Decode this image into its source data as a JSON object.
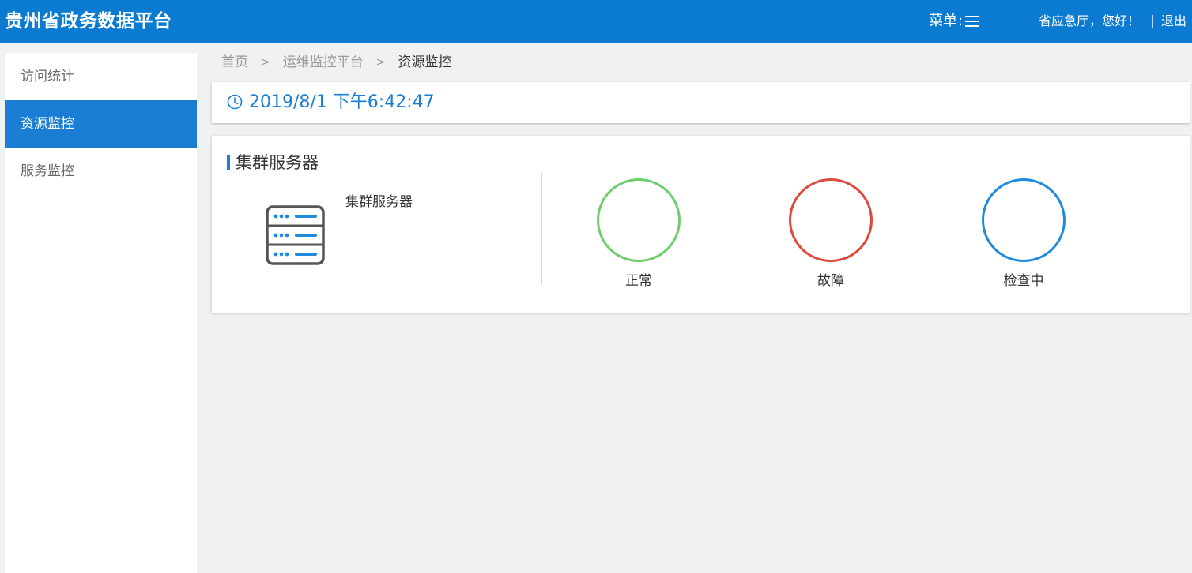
{
  "header": {
    "app_title": "贵州省政务数据平台",
    "menu_label": "菜单",
    "greeting": "省应急厅，您好！",
    "logout_label": "退出"
  },
  "sidebar": {
    "items": [
      {
        "label": "访问统计",
        "active": false
      },
      {
        "label": "资源监控",
        "active": true
      },
      {
        "label": "服务监控",
        "active": false
      }
    ]
  },
  "breadcrumb": {
    "items": [
      "首页",
      "运维监控平台",
      "资源监控"
    ],
    "separator": ">"
  },
  "time_card": {
    "datetime": "2019/8/1 下午6:42:47"
  },
  "cluster_card": {
    "title": "集群服务器",
    "server_label": "集群服务器",
    "statuses": [
      {
        "label": "正常",
        "color": "#6fcd6f"
      },
      {
        "label": "故障",
        "color": "#db4a3c"
      },
      {
        "label": "检查中",
        "color": "#1e8ae0"
      }
    ]
  },
  "colors": {
    "brand": "#0b7ad1",
    "active_nav": "#1a7fd4",
    "accent": "#1a7fd4"
  }
}
